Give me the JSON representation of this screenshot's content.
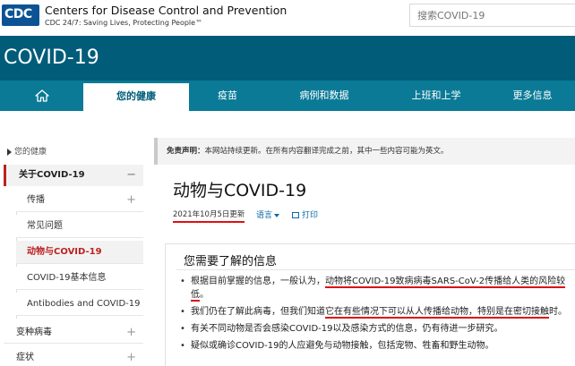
{
  "header": {
    "logo_text": "CDC",
    "org_name": "Centers for Disease Control and Prevention",
    "tagline": "CDC 24/7: Saving Lives, Protecting People™",
    "search_placeholder": "搜索COVID-19"
  },
  "title_band": {
    "title": "COVID-19"
  },
  "nav": {
    "items": [
      {
        "label": ""
      },
      {
        "label": "您的健康"
      },
      {
        "label": "疫苗"
      },
      {
        "label": "病例和数据"
      },
      {
        "label": "上班和上学"
      },
      {
        "label": "更多信息"
      }
    ]
  },
  "sidebar": {
    "home_link": "您的健康",
    "section_title": "关于COVID-19",
    "section_toggle": "−",
    "sub_items": [
      {
        "label": "传播",
        "toggle": "+"
      },
      {
        "label": "常见问题",
        "toggle": ""
      },
      {
        "label": "动物与COVID-19",
        "toggle": ""
      },
      {
        "label": "COVID-19基本信息",
        "toggle": ""
      },
      {
        "label": "Antibodies and COVID-19",
        "toggle": ""
      }
    ],
    "top_items": [
      {
        "label": "变种病毒",
        "toggle": "+"
      },
      {
        "label": "症状",
        "toggle": "+"
      }
    ]
  },
  "main": {
    "disclaimer_label": "免责声明：",
    "disclaimer_text": "本网站持续更新。在所有内容翻译完成之前，其中一些内容可能为英文。",
    "title": "动物与COVID-19",
    "updated": "2021年10月5日更新",
    "language_label": "语言",
    "print_label": "打印",
    "card_title": "您需要了解的信息",
    "bullets": [
      {
        "pre": "根据目前掌握的信息，一般认为，",
        "highlight": "动物将COVID-19致病病毒SARS-CoV-2传播给人类的风险较低",
        "post": "。"
      },
      {
        "pre": "我们仍在了解此病毒，但我们知道",
        "highlight": "它在有些情况下可以从人传播给动物，特别是在密切接触",
        "post": "时。"
      },
      {
        "pre": "有关不同动物是否会感染COVID-19以及感染方式的信息，仍有待进一步研究。",
        "highlight": "",
        "post": ""
      },
      {
        "pre": "疑似或确诊COVID-19的人应避免与动物接触，包括宠物、牲畜和野生动物。",
        "highlight": "",
        "post": ""
      }
    ]
  },
  "colors": {
    "brand_dark": "#005c79",
    "nav": "#0a7a96",
    "accent_red": "#d11111",
    "link": "#0b6aa8"
  },
  "icons": {
    "home": "home-icon",
    "print": "print-icon",
    "caret": "caret-down-icon",
    "sidebar_home": "triangle-right-icon"
  }
}
